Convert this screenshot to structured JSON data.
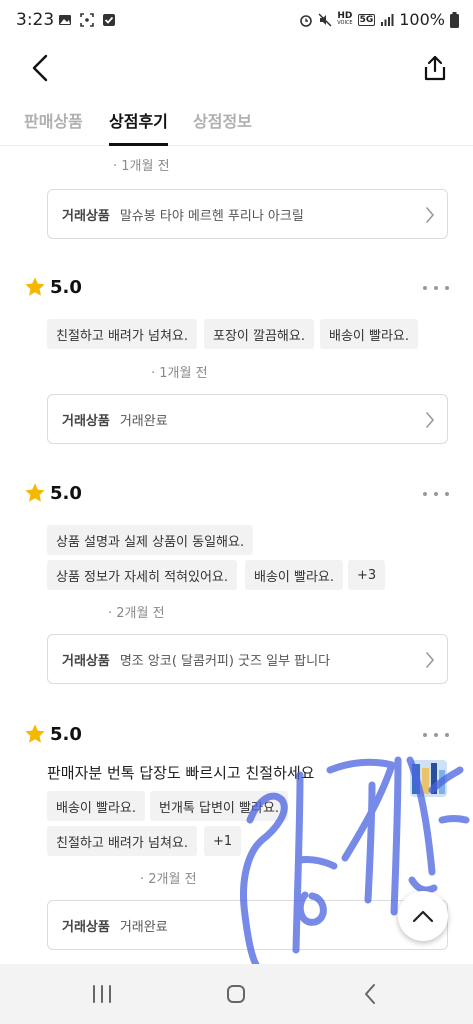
{
  "status_bar": {
    "time": "3:23",
    "battery": "100%",
    "icons_left": [
      "image-icon",
      "screenshot-icon",
      "checkbox-icon"
    ],
    "icons_right": [
      "alarm-icon",
      "mute-icon",
      "hd-voice-icon",
      "5g-icon",
      "signal-icon",
      "battery-icon"
    ],
    "hd_label": "HD",
    "voice_label": "VOICE",
    "network_label": "5G"
  },
  "tabs": [
    {
      "label": "판매상품",
      "active": false
    },
    {
      "label": "상점후기",
      "active": true
    },
    {
      "label": "상점정보",
      "active": false
    }
  ],
  "reviews": [
    {
      "date": "1개월 전",
      "product_label": "거래상품",
      "product_name": "말슈봉 타야 메르헨 푸리나 아크릴"
    },
    {
      "score": "5.0",
      "tags": [
        "친절하고 배려가 넘쳐요.",
        "포장이 깔끔해요.",
        "배송이 빨라요."
      ],
      "date": "1개월 전",
      "product_label": "거래상품",
      "product_name": "거래완료"
    },
    {
      "score": "5.0",
      "tags": [
        "상품 설명과 실제 상품이 동일해요.",
        "상품 정보가 자세히 적혀있어요.",
        "배송이 빨라요.",
        "+3"
      ],
      "date": "2개월 전",
      "product_label": "거래상품",
      "product_name": "명조 앙코( 달콤커피) 굿즈 일부 팝니다"
    },
    {
      "score": "5.0",
      "text": "판매자분 번톡 답장도 빠르시고 친절하세요",
      "tags": [
        "배송이 빨라요.",
        "번개톡 답변이 빨라요.",
        "친절하고 배려가 넘쳐요.",
        "+1"
      ],
      "date": "2개월 전",
      "product_label": "거래상품",
      "product_name": "거래완료"
    }
  ],
  "colors": {
    "star": "#F5B800",
    "scribble": "#4a63e0",
    "chip_bg": "#f2f2f2"
  }
}
